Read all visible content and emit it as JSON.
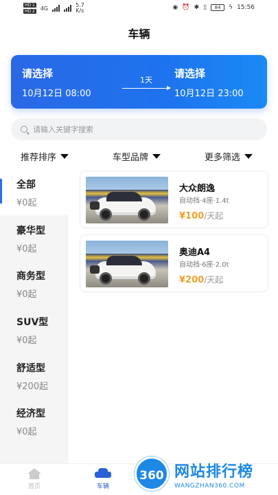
{
  "status_bar": {
    "sim1": "HD 1",
    "sim2": "HD 2",
    "network": "4G",
    "speed": "5.7",
    "speed_unit": "K/s",
    "battery": "84",
    "time": "15:56"
  },
  "header": {
    "title": "车辆"
  },
  "date_range": {
    "start_label": "请选择",
    "start_datetime": "10月12日 08:00",
    "duration": "1天",
    "end_label": "请选择",
    "end_datetime": "10月12日 23:00"
  },
  "search": {
    "placeholder": "请输入关键字搜索"
  },
  "filters": [
    {
      "label": "推荐排序"
    },
    {
      "label": "车型品牌"
    },
    {
      "label": "更多筛选"
    }
  ],
  "categories": [
    {
      "name": "全部",
      "price": "¥0起",
      "active": true
    },
    {
      "name": "豪华型",
      "price": "¥0起"
    },
    {
      "name": "商务型",
      "price": "¥0起"
    },
    {
      "name": "SUV型",
      "price": "¥0起"
    },
    {
      "name": "舒适型",
      "price": "¥200起"
    },
    {
      "name": "经济型",
      "price": "¥0起"
    }
  ],
  "cars": [
    {
      "name": "大众朗逸",
      "spec": "自动挡·4座·1.4t",
      "price": "¥100",
      "unit": "/天起"
    },
    {
      "name": "奥迪A4",
      "spec": "自动挡·6座·2.0t",
      "price": "¥200",
      "unit": "/天起"
    }
  ],
  "tabbar": {
    "home_label": "首页",
    "car_label": "车辆"
  },
  "watermark": {
    "logo": "360",
    "text": "网站排行榜",
    "url": "WANGZHAN360.COM"
  },
  "colors": {
    "primary": "#2a6ef0",
    "price": "#f0a22c"
  }
}
